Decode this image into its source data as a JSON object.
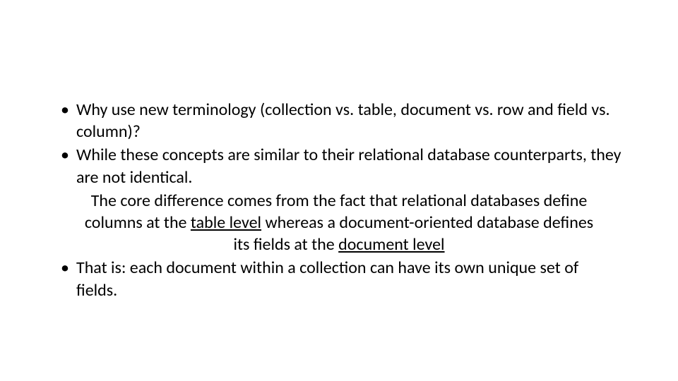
{
  "slide": {
    "bullets": [
      "Why use new terminology (collection vs. table, document vs. row and field vs. column)?",
      "While these concepts are similar to their relational database counterparts, they are not identical."
    ],
    "sub_before": "The core difference comes from the fact that relational databases define columns at the ",
    "underline1": "table level",
    "sub_mid": " whereas a document-oriented database defines its fields at the ",
    "underline2": "document level",
    "bullet3": "That is: each document within a collection can have its own unique set of fields."
  }
}
